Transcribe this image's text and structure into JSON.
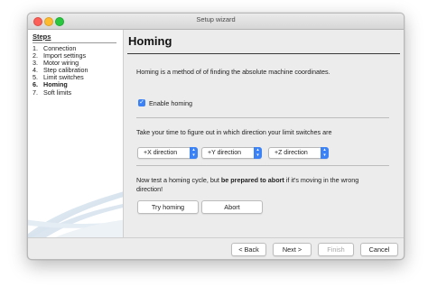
{
  "window": {
    "title": "Setup wizard"
  },
  "sidebar": {
    "heading": "Steps",
    "steps": [
      {
        "num": "1.",
        "label": "Connection"
      },
      {
        "num": "2.",
        "label": "Import settings"
      },
      {
        "num": "3.",
        "label": "Motor wiring"
      },
      {
        "num": "4.",
        "label": "Step calibration"
      },
      {
        "num": "5.",
        "label": "Limit switches"
      },
      {
        "num": "6.",
        "label": "Homing",
        "active": true
      },
      {
        "num": "7.",
        "label": "Soft limits"
      }
    ]
  },
  "page": {
    "title": "Homing",
    "description": "Homing is a method of of finding the absolute machine coordinates.",
    "enable_homing": {
      "label": "Enable homing",
      "checked": true
    },
    "direction_prompt": "Take your time to figure out in which direction your limit switches are",
    "directions": [
      {
        "name": "x",
        "value": "+X direction"
      },
      {
        "name": "y",
        "value": "+Y direction"
      },
      {
        "name": "z",
        "value": "+Z direction"
      }
    ],
    "test_prompt": {
      "before": "Now test a homing cycle, but ",
      "bold": "be prepared to abort",
      "after": " if it's moving in the wrong",
      "line2": "direction!"
    },
    "try_homing_label": "Try homing",
    "abort_label": "Abort"
  },
  "footer": {
    "back_label": "< Back",
    "next_label": "Next >",
    "finish_label": "Finish",
    "cancel_label": "Cancel"
  },
  "colors": {
    "accent": "#3b82f6"
  }
}
